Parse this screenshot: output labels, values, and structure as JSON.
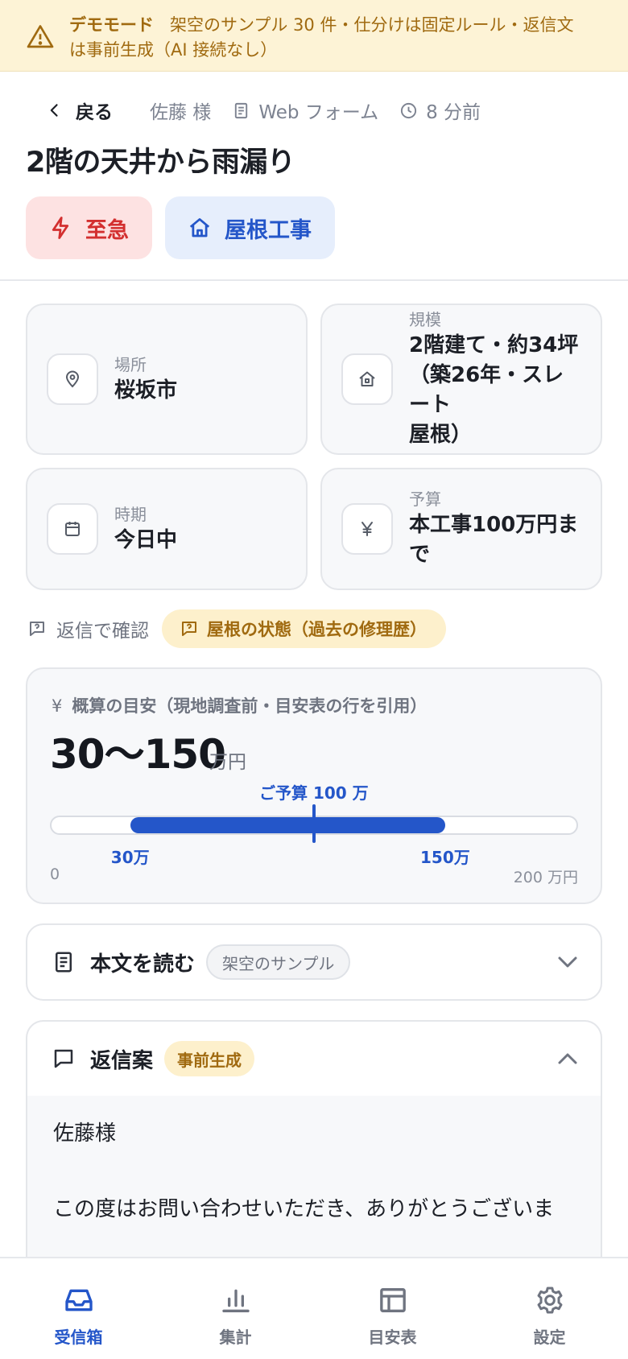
{
  "banner": {
    "label": "デモモード",
    "text": "架空のサンプル 30 件・仕分けは固定ルール・返信文",
    "text2": "は事前生成（AI 接続なし）"
  },
  "header": {
    "back_label": "戻る",
    "customer": "佐藤 様",
    "source": "Web フォーム",
    "time": "8 分前"
  },
  "title": "2階の天井から雨漏り",
  "tags": {
    "urgency": "至急",
    "category": "屋根工事"
  },
  "info": {
    "location_label": "場所",
    "location_value": "桜坂市",
    "scale_label": "規模",
    "scale_value_1": "2階建て・約34坪",
    "scale_value_2": "（築26年・スレート",
    "scale_value_3": "屋根）",
    "timing_label": "時期",
    "timing_value": "今日中",
    "budget_label": "予算",
    "budget_value_1": "本工事100万円ま",
    "budget_value_2": "で"
  },
  "confirm": {
    "label": "返信で確認",
    "chip": "屋根の状態（過去の修理歴）"
  },
  "estimate": {
    "label": "概算の目安（現地調査前・目安表の行を引用）",
    "range": "30〜150",
    "unit": "万円",
    "budget_marker_label": "ご予算 100 万",
    "min_label": "30万",
    "max_label": "150万",
    "axis_min_label": "0",
    "axis_max_label": "200 万円",
    "scale_min": 0,
    "scale_max": 200,
    "low": 30,
    "high": 150,
    "budget": 100
  },
  "body_section": {
    "title": "本文を読む",
    "chip": "架空のサンプル"
  },
  "reply_section": {
    "title": "返信案",
    "chip": "事前生成",
    "greeting": "佐藤様",
    "line1": "この度はお問い合わせいただき、ありがとうございま"
  },
  "nav": {
    "inbox": "受信箱",
    "stats": "集計",
    "table": "目安表",
    "settings": "設定"
  },
  "colors": {
    "accent": "#2456c9",
    "urgent": "#d32f2f",
    "banner_bg": "#fdf3d6",
    "banner_text": "#a06a10"
  }
}
